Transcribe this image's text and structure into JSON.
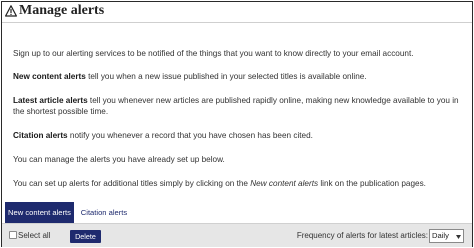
{
  "header": {
    "icon": "warning-triangle-icon",
    "title": "Manage alerts"
  },
  "content": {
    "intro": "Sign up to our alerting services to be notified of the things that you want to know directly to your email account.",
    "new_content": {
      "bold": "New content alerts",
      "text": " tell you when a new issue published in your selected titles is available online."
    },
    "latest_article": {
      "bold": "Latest article alerts",
      "text": " tell you whenever new articles are published rapidly online, making new knowledge available to you in the shortest possible time."
    },
    "citation": {
      "bold": "Citation alerts",
      "text": " notify you whenever a record that you have chosen has been cited."
    },
    "manage": "You can manage the alerts you have already set up below.",
    "setup": {
      "before": "You can set up alerts for additional titles simply by clicking on the ",
      "italic": "New content alerts",
      "after": " link on the publication pages."
    }
  },
  "tabs": [
    {
      "label": "New content alerts",
      "active": true
    },
    {
      "label": "Citation alerts",
      "active": false
    }
  ],
  "toolbar": {
    "select_all_label": "Select all",
    "select_all_checked": false,
    "delete_label": "Delete",
    "frequency_label": "Frequency of alerts for latest articles:",
    "frequency_value": "Daily"
  },
  "colors": {
    "accent": "#1e2a6e",
    "toolbar_bg": "#e6e6e6"
  }
}
